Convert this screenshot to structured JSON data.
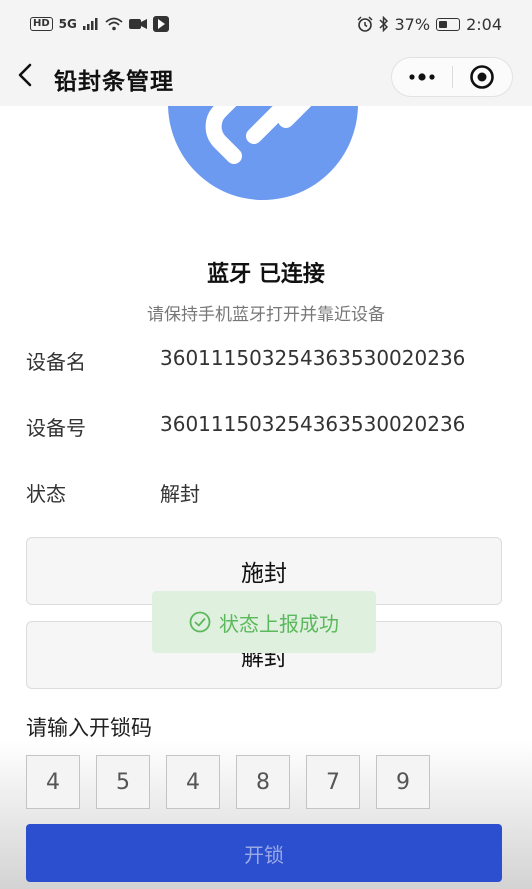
{
  "status_bar": {
    "left_icons": [
      "HD",
      "5G",
      "signal-icon",
      "wifi-icon",
      "video-icon",
      "app-icon"
    ],
    "battery": "37%",
    "time": "2:04"
  },
  "nav": {
    "title": "铅封条管理",
    "capsule_more": "•••"
  },
  "device": {
    "bluetooth_status": "蓝牙 已连接",
    "bluetooth_hint": "请保持手机蓝牙打开并靠近设备",
    "fields": [
      {
        "label": "设备名",
        "value": "36011150325436353002023​6"
      },
      {
        "label": "设备号",
        "value": "360111503254363530020236"
      },
      {
        "label": "状态",
        "value": "解封"
      }
    ]
  },
  "actions": {
    "seal": "施封",
    "unseal": "解封"
  },
  "toast": {
    "text": "状态上报成功"
  },
  "unlock": {
    "label": "请输入开锁码",
    "digits": [
      "4",
      "5",
      "4",
      "8",
      "7",
      "9"
    ],
    "button": "开锁"
  },
  "colors": {
    "accent_blue": "#6c9af0",
    "button_blue": "#2b4fcf",
    "toast_green": "#5cb85c"
  }
}
